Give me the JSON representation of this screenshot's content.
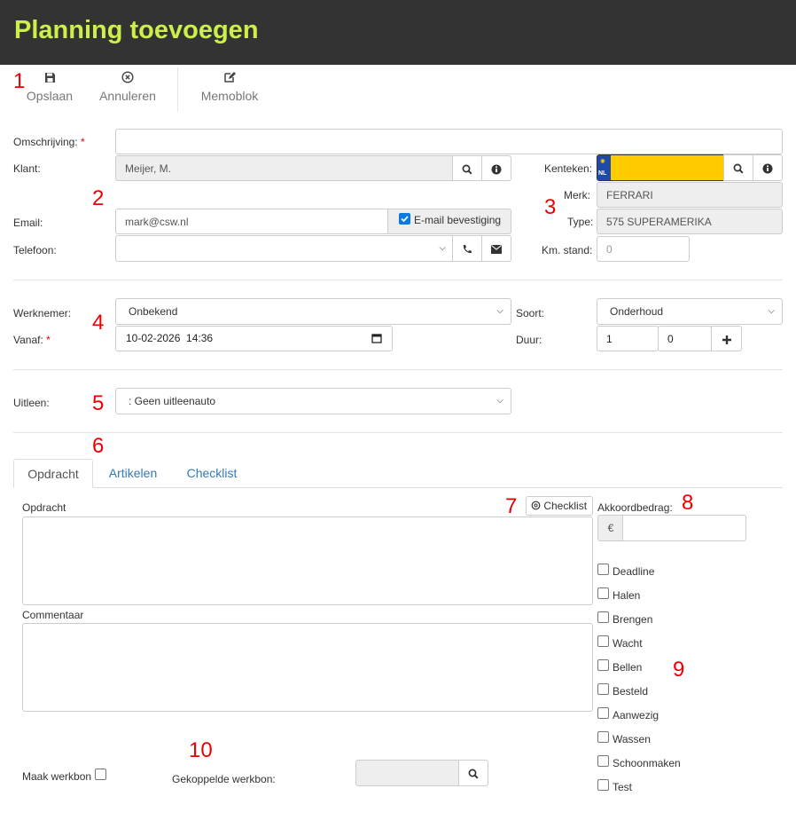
{
  "header": {
    "title": "Planning toevoegen"
  },
  "toolbar": {
    "save_label": "Opslaan",
    "cancel_label": "Annuleren",
    "memo_label": "Memoblok"
  },
  "markers": [
    "1",
    "2",
    "3",
    "4",
    "5",
    "6",
    "7",
    "8",
    "9",
    "10"
  ],
  "form": {
    "omschrijving_label": "Omschrijving:",
    "required_mark": "*",
    "klant_label": "Klant:",
    "klant_value": "Meijer, M.",
    "email_label": "Email:",
    "email_value": "mark@csw.nl",
    "email_confirm_label": "E-mail bevestiging",
    "telefoon_label": "Telefoon:",
    "kenteken_label": "Kenteken:",
    "plate_country": "NL",
    "merk_label": "Merk:",
    "merk_value": "FERRARI",
    "type_label": "Type:",
    "type_value": "575 SUPERAMERIKA",
    "km_label": "Km. stand:",
    "km_placeholder": "0",
    "werknemer_label": "Werknemer:",
    "werknemer_value": "Onbekend",
    "soort_label": "Soort:",
    "soort_value": "Onderhoud",
    "vanaf_label": "Vanaf:",
    "vanaf_value": "10-02-2026  14:36",
    "duur_label": "Duur:",
    "duur_value1": "1",
    "duur_value2": "0",
    "uitleen_label": "Uitleen:",
    "uitleen_value": ": Geen uitleenauto"
  },
  "tabs": {
    "opdracht": "Opdracht",
    "artikelen": "Artikelen",
    "checklist": "Checklist"
  },
  "panel": {
    "opdracht_label": "Opdracht",
    "checklist_button": "Checklist",
    "commentaar_label": "Commentaar",
    "akkoord_label": "Akkoordbedrag:",
    "currency": "€",
    "checkboxes": [
      "Deadline",
      "Halen",
      "Brengen",
      "Wacht",
      "Bellen",
      "Besteld",
      "Aanwezig",
      "Wassen",
      "Schoonmaken",
      "Test"
    ],
    "maak_werkbon_label": "Maak werkbon",
    "gekoppelde_label": "Gekoppelde werkbon:"
  },
  "colors": {
    "header_bg": "#333333",
    "title": "#ccef4a",
    "marker": "#e00000",
    "link": "#337ab7",
    "plate": "#ffcc00"
  }
}
